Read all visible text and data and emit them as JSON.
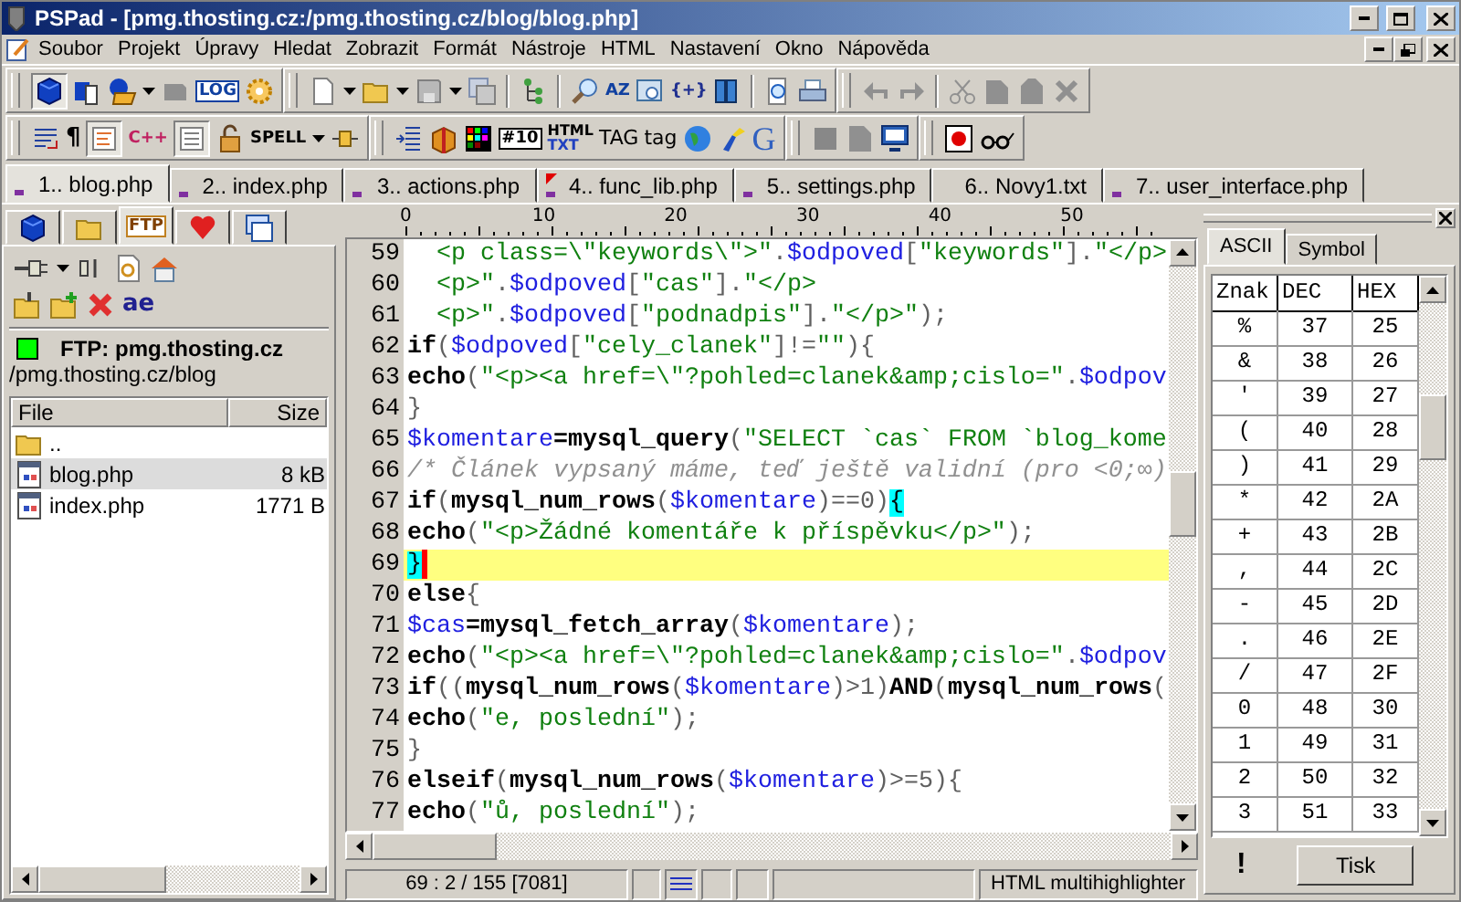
{
  "window": {
    "title": "PSPad - [pmg.thosting.cz:/pmg.thosting.cz/blog/blog.php]"
  },
  "menu": [
    "Soubor",
    "Projekt",
    "Úpravy",
    "Hledat",
    "Zobrazit",
    "Formát",
    "Nástroje",
    "HTML",
    "Nastavení",
    "Okno",
    "Nápověda"
  ],
  "toolbar_texts": {
    "log": "LOG",
    "az": "AZ",
    "braces": "{+}",
    "pilcrow": "¶",
    "cpp": "C++",
    "spell": "SPELL",
    "grid_number": "#10",
    "html": "HTML",
    "txt": "TXT",
    "tag_upper": "TAG",
    "tag_lower": "tag",
    "g": "G"
  },
  "toolbar_toggles": [
    {
      "pressed": true
    },
    {
      "pressed": true
    },
    {
      "pressed": true
    }
  ],
  "tabs": [
    {
      "label": "1.. blog.php",
      "selected": true,
      "remote": true,
      "modified": false
    },
    {
      "label": "2.. index.php",
      "selected": false,
      "remote": true,
      "modified": false
    },
    {
      "label": "3.. actions.php",
      "selected": false,
      "remote": true,
      "modified": false
    },
    {
      "label": "4.. func_lib.php",
      "selected": false,
      "remote": true,
      "modified": true
    },
    {
      "label": "5.. settings.php",
      "selected": false,
      "remote": true,
      "modified": false
    },
    {
      "label": "6.. Novy1.txt",
      "selected": false,
      "remote": false,
      "modified": false
    },
    {
      "label": "7.. user_interface.php",
      "selected": false,
      "remote": true,
      "modified": false
    }
  ],
  "side_panel": {
    "tabs": [
      {
        "selected": false
      },
      {
        "selected": false
      },
      {
        "selected": true,
        "label": "FTP"
      },
      {
        "selected": false
      },
      {
        "selected": false
      }
    ],
    "rename_label": "ae",
    "connection": {
      "connected": true,
      "label": "FTP: pmg.thosting.cz"
    },
    "path": "/pmg.thosting.cz/blog",
    "columns": [
      "File",
      "Size"
    ],
    "files": [
      {
        "name": "..",
        "kind": "folder",
        "selected": false
      },
      {
        "name": "blog.php",
        "size": "8 kB",
        "kind": "file",
        "selected": true
      },
      {
        "name": "index.php",
        "size": "1771 B",
        "kind": "file",
        "selected": false
      }
    ]
  },
  "editor": {
    "ruler": [
      "0",
      "10",
      "20",
      "30",
      "40",
      "50"
    ],
    "lines": [
      {
        "number": "59",
        "current": false,
        "tokens": [
          {
            "kind": "str",
            "text": "  <p class=\\\"keywords\\\">\""
          },
          {
            "kind": "punct",
            "text": "."
          },
          {
            "kind": "var",
            "text": "$odpoved"
          },
          {
            "kind": "punct",
            "text": "["
          },
          {
            "kind": "str",
            "text": "\"keywords\""
          },
          {
            "kind": "punct",
            "text": "]."
          },
          {
            "kind": "str",
            "text": "\"</p>"
          }
        ]
      },
      {
        "number": "60",
        "current": false,
        "tokens": [
          {
            "kind": "str",
            "text": "  <p>\""
          },
          {
            "kind": "punct",
            "text": "."
          },
          {
            "kind": "var",
            "text": "$odpoved"
          },
          {
            "kind": "punct",
            "text": "["
          },
          {
            "kind": "str",
            "text": "\"cas\""
          },
          {
            "kind": "punct",
            "text": "]."
          },
          {
            "kind": "str",
            "text": "\"</p>"
          }
        ]
      },
      {
        "number": "61",
        "current": false,
        "tokens": [
          {
            "kind": "str",
            "text": "  <p>\""
          },
          {
            "kind": "punct",
            "text": "."
          },
          {
            "kind": "var",
            "text": "$odpoved"
          },
          {
            "kind": "punct",
            "text": "["
          },
          {
            "kind": "str",
            "text": "\"podnadpis\""
          },
          {
            "kind": "punct",
            "text": "]."
          },
          {
            "kind": "str",
            "text": "\"</p>\""
          },
          {
            "kind": "punct",
            "text": ");"
          }
        ]
      },
      {
        "number": "62",
        "current": false,
        "tokens": [
          {
            "kind": "code",
            "text": "if"
          },
          {
            "kind": "punct",
            "text": "("
          },
          {
            "kind": "var",
            "text": "$odpoved"
          },
          {
            "kind": "punct",
            "text": "["
          },
          {
            "kind": "str",
            "text": "\"cely_clanek\""
          },
          {
            "kind": "punct",
            "text": "]!="
          },
          {
            "kind": "str",
            "text": "\"\""
          },
          {
            "kind": "punct",
            "text": "){"
          }
        ]
      },
      {
        "number": "63",
        "current": false,
        "tokens": [
          {
            "kind": "code",
            "text": "echo"
          },
          {
            "kind": "punct",
            "text": "("
          },
          {
            "kind": "str",
            "text": "\"<p><a href=\\\"?pohled=clanek&amp;cislo=\""
          },
          {
            "kind": "punct",
            "text": "."
          },
          {
            "kind": "var",
            "text": "$odpov"
          }
        ]
      },
      {
        "number": "64",
        "current": false,
        "tokens": [
          {
            "kind": "punct",
            "text": "}"
          }
        ]
      },
      {
        "number": "65",
        "current": false,
        "tokens": [
          {
            "kind": "var",
            "text": "$komentare"
          },
          {
            "kind": "code",
            "text": "=mysql_query"
          },
          {
            "kind": "punct",
            "text": "("
          },
          {
            "kind": "str",
            "text": "\"SELECT `cas` FROM `blog_kome"
          }
        ]
      },
      {
        "number": "66",
        "current": false,
        "tokens": [
          {
            "kind": "comment",
            "text": "/* Článek vypsaný máme, teď ještě validní (pro <0;∞)"
          }
        ]
      },
      {
        "number": "67",
        "current": false,
        "tokens": [
          {
            "kind": "code",
            "text": "if"
          },
          {
            "kind": "punct",
            "text": "("
          },
          {
            "kind": "code",
            "text": "mysql_num_rows"
          },
          {
            "kind": "punct",
            "text": "("
          },
          {
            "kind": "var",
            "text": "$komentare"
          },
          {
            "kind": "punct",
            "text": ")==0)"
          },
          {
            "kind": "match",
            "text": "{"
          }
        ]
      },
      {
        "number": "68",
        "current": false,
        "tokens": [
          {
            "kind": "code",
            "text": "echo"
          },
          {
            "kind": "punct",
            "text": "("
          },
          {
            "kind": "str",
            "text": "\"<p>Žádné komentáře k příspěvku</p>\""
          },
          {
            "kind": "punct",
            "text": ");"
          }
        ]
      },
      {
        "number": "69",
        "current": true,
        "tokens": [
          {
            "kind": "match",
            "text": "}"
          }
        ]
      },
      {
        "number": "70",
        "current": false,
        "tokens": [
          {
            "kind": "code",
            "text": "else"
          },
          {
            "kind": "punct",
            "text": "{"
          }
        ]
      },
      {
        "number": "71",
        "current": false,
        "tokens": [
          {
            "kind": "var",
            "text": "$cas"
          },
          {
            "kind": "code",
            "text": "=mysql_fetch_array"
          },
          {
            "kind": "punct",
            "text": "("
          },
          {
            "kind": "var",
            "text": "$komentare"
          },
          {
            "kind": "punct",
            "text": ");"
          }
        ]
      },
      {
        "number": "72",
        "current": false,
        "tokens": [
          {
            "kind": "code",
            "text": "echo"
          },
          {
            "kind": "punct",
            "text": "("
          },
          {
            "kind": "str",
            "text": "\"<p><a href=\\\"?pohled=clanek&amp;cislo=\""
          },
          {
            "kind": "punct",
            "text": "."
          },
          {
            "kind": "var",
            "text": "$odpov"
          }
        ]
      },
      {
        "number": "73",
        "current": false,
        "tokens": [
          {
            "kind": "code",
            "text": "if"
          },
          {
            "kind": "punct",
            "text": "(("
          },
          {
            "kind": "code",
            "text": "mysql_num_rows"
          },
          {
            "kind": "punct",
            "text": "("
          },
          {
            "kind": "var",
            "text": "$komentare"
          },
          {
            "kind": "punct",
            "text": ")>1)"
          },
          {
            "kind": "code",
            "text": "AND"
          },
          {
            "kind": "punct",
            "text": "("
          },
          {
            "kind": "code",
            "text": "mysql_num_rows"
          },
          {
            "kind": "punct",
            "text": "("
          }
        ]
      },
      {
        "number": "74",
        "current": false,
        "tokens": [
          {
            "kind": "code",
            "text": "echo"
          },
          {
            "kind": "punct",
            "text": "("
          },
          {
            "kind": "str",
            "text": "\"e, poslední\""
          },
          {
            "kind": "punct",
            "text": ");"
          }
        ]
      },
      {
        "number": "75",
        "current": false,
        "tokens": [
          {
            "kind": "punct",
            "text": "}"
          }
        ]
      },
      {
        "number": "76",
        "current": false,
        "tokens": [
          {
            "kind": "code",
            "text": "elseif"
          },
          {
            "kind": "punct",
            "text": "("
          },
          {
            "kind": "code",
            "text": "mysql_num_rows"
          },
          {
            "kind": "punct",
            "text": "("
          },
          {
            "kind": "var",
            "text": "$komentare"
          },
          {
            "kind": "punct",
            "text": ")>=5){"
          }
        ]
      },
      {
        "number": "77",
        "current": false,
        "tokens": [
          {
            "kind": "code",
            "text": "echo"
          },
          {
            "kind": "punct",
            "text": "("
          },
          {
            "kind": "str",
            "text": "\"ů, poslední\""
          },
          {
            "kind": "punct",
            "text": ");"
          }
        ]
      }
    ]
  },
  "status_bar": {
    "position": "69 : 2 / 155  [7081]",
    "highlighter": "HTML multihighlighter"
  },
  "ascii_panel": {
    "tabs": [
      {
        "label": "ASCII",
        "selected": true
      },
      {
        "label": "Symbol",
        "selected": false
      }
    ],
    "columns": [
      "Znak",
      "DEC",
      "HEX"
    ],
    "rows": [
      {
        "char": "%",
        "dec": "37",
        "hex": "25"
      },
      {
        "char": "&",
        "dec": "38",
        "hex": "26"
      },
      {
        "char": "'",
        "dec": "39",
        "hex": "27"
      },
      {
        "char": "(",
        "dec": "40",
        "hex": "28"
      },
      {
        "char": ")",
        "dec": "41",
        "hex": "29"
      },
      {
        "char": "*",
        "dec": "42",
        "hex": "2A"
      },
      {
        "char": "+",
        "dec": "43",
        "hex": "2B"
      },
      {
        "char": ",",
        "dec": "44",
        "hex": "2C"
      },
      {
        "char": "-",
        "dec": "45",
        "hex": "2D"
      },
      {
        "char": ".",
        "dec": "46",
        "hex": "2E"
      },
      {
        "char": "/",
        "dec": "47",
        "hex": "2F"
      },
      {
        "char": "0",
        "dec": "48",
        "hex": "30"
      },
      {
        "char": "1",
        "dec": "49",
        "hex": "31"
      },
      {
        "char": "2",
        "dec": "50",
        "hex": "32"
      },
      {
        "char": "3",
        "dec": "51",
        "hex": "33"
      }
    ],
    "note": "!",
    "button": "Tisk"
  }
}
